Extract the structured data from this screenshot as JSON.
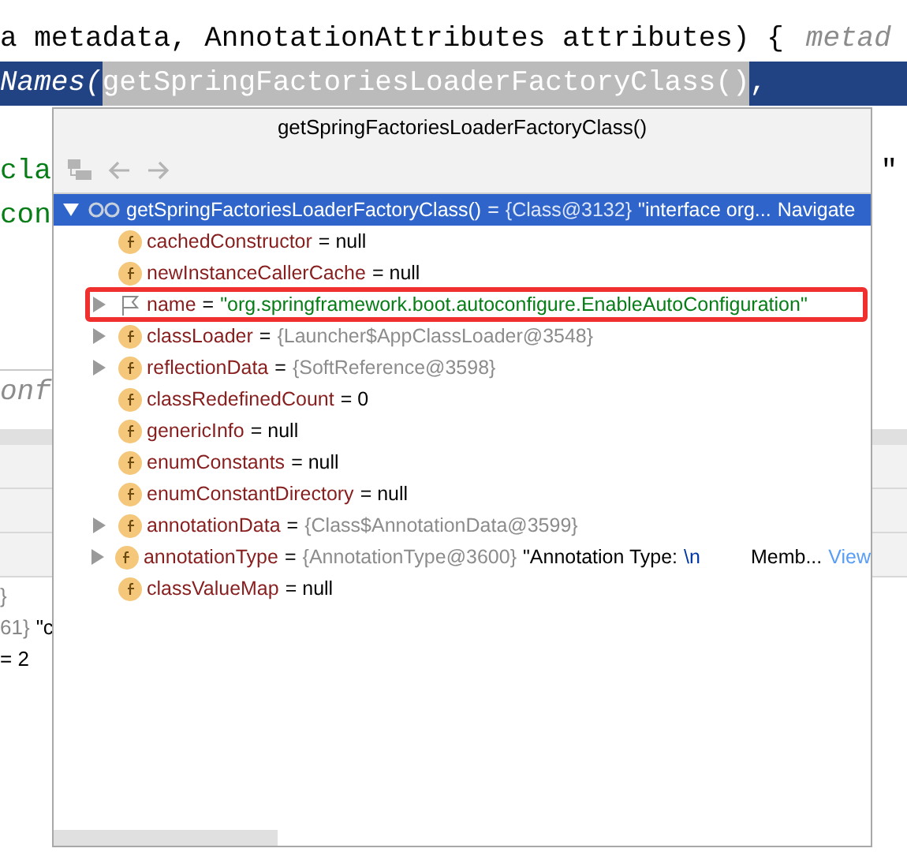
{
  "editor": {
    "lines": [
      {
        "kind": "code",
        "selected": false,
        "segments": [
          {
            "text": "a metadata, AnnotationAttributes attributes) {",
            "kind": "code"
          },
          {
            "text": "metad",
            "kind": "hint"
          }
        ]
      },
      {
        "kind": "code",
        "selected": true,
        "segments": [
          {
            "text": "Names(",
            "kind": "italic"
          },
          {
            "text": "getSpringFactoriesLoaderFactoryClass()",
            "kind": "evaluated"
          },
          {
            "text": ",",
            "kind": "code"
          }
        ]
      },
      {
        "kind": "blank"
      },
      {
        "kind": "edge",
        "left": {
          "text": "cla",
          "kind": "string"
        },
        "right": {
          "text": "\"",
          "kind": "code"
        }
      },
      {
        "kind": "edge",
        "left": {
          "text": "con",
          "kind": "string"
        }
      },
      {
        "kind": "blank"
      },
      {
        "kind": "blank"
      },
      {
        "kind": "divider"
      },
      {
        "kind": "edge",
        "left": {
          "text": "onf",
          "kind": "hint"
        }
      }
    ]
  },
  "console": {
    "lines": [
      {
        "segments": [
          {
            "text": "}",
            "kind": "ref"
          }
        ]
      },
      {
        "segments": [
          {
            "text": "61}",
            "kind": "ref"
          },
          {
            "text": "\"c",
            "kind": "plain"
          }
        ]
      },
      {
        "segments": [
          {
            "text": "= 2",
            "kind": "plain"
          }
        ]
      }
    ]
  },
  "popup": {
    "title": "getSpringFactoriesLoaderFactoryClass()",
    "toolbar": [
      {
        "kind": "hierarchy",
        "disabled": true
      },
      {
        "kind": "back",
        "disabled": true
      },
      {
        "kind": "forward",
        "disabled": true
      }
    ],
    "root": {
      "name": "getSpringFactoriesLoaderFactoryClass()",
      "expanded": true,
      "selected": true,
      "value": [
        {
          "text": "=",
          "kind": "plain"
        },
        {
          "text": "{Class@3132}",
          "kind": "ref"
        },
        {
          "text": "\"interface org...",
          "kind": "plain"
        }
      ],
      "link": "Navigate"
    },
    "children": [
      {
        "kind": "field",
        "expandable": false,
        "name": "cachedConstructor",
        "value": [
          {
            "text": "= null",
            "kind": "plain"
          }
        ]
      },
      {
        "kind": "field",
        "expandable": false,
        "name": "newInstanceCallerCache",
        "value": [
          {
            "text": "= null",
            "kind": "plain"
          }
        ]
      },
      {
        "kind": "flag",
        "expandable": true,
        "highlighted": true,
        "name": "name",
        "value": [
          {
            "text": "=",
            "kind": "plain"
          },
          {
            "text": "\"org.springframework.boot.autoconfigure.EnableAutoConfiguration\"",
            "kind": "string"
          }
        ]
      },
      {
        "kind": "field",
        "expandable": true,
        "name": "classLoader",
        "value": [
          {
            "text": "=",
            "kind": "plain"
          },
          {
            "text": "{Launcher$AppClassLoader@3548}",
            "kind": "ref"
          }
        ]
      },
      {
        "kind": "field",
        "expandable": true,
        "name": "reflectionData",
        "value": [
          {
            "text": "=",
            "kind": "plain"
          },
          {
            "text": "{SoftReference@3598}",
            "kind": "ref"
          }
        ]
      },
      {
        "kind": "field",
        "expandable": false,
        "name": "classRedefinedCount",
        "value": [
          {
            "text": "= 0",
            "kind": "plain"
          }
        ]
      },
      {
        "kind": "field",
        "expandable": false,
        "name": "genericInfo",
        "value": [
          {
            "text": "= null",
            "kind": "plain"
          }
        ]
      },
      {
        "kind": "field",
        "expandable": false,
        "name": "enumConstants",
        "value": [
          {
            "text": "= null",
            "kind": "plain"
          }
        ]
      },
      {
        "kind": "field",
        "expandable": false,
        "name": "enumConstantDirectory",
        "value": [
          {
            "text": "= null",
            "kind": "plain"
          }
        ]
      },
      {
        "kind": "field",
        "expandable": true,
        "name": "annotationData",
        "value": [
          {
            "text": "=",
            "kind": "plain"
          },
          {
            "text": "{Class$AnnotationData@3599}",
            "kind": "ref"
          }
        ]
      },
      {
        "kind": "field",
        "expandable": true,
        "name": "annotationType",
        "value": [
          {
            "text": "=",
            "kind": "plain"
          },
          {
            "text": "{AnnotationType@3600}",
            "kind": "ref"
          },
          {
            "text": "\"Annotation Type:",
            "kind": "plain"
          },
          {
            "text": "\\n",
            "kind": "escape"
          },
          {
            "text": "Memb...",
            "kind": "plain"
          }
        ],
        "link": "View"
      },
      {
        "kind": "field",
        "expandable": false,
        "name": "classValueMap",
        "value": [
          {
            "text": "= null",
            "kind": "plain"
          }
        ]
      }
    ]
  }
}
